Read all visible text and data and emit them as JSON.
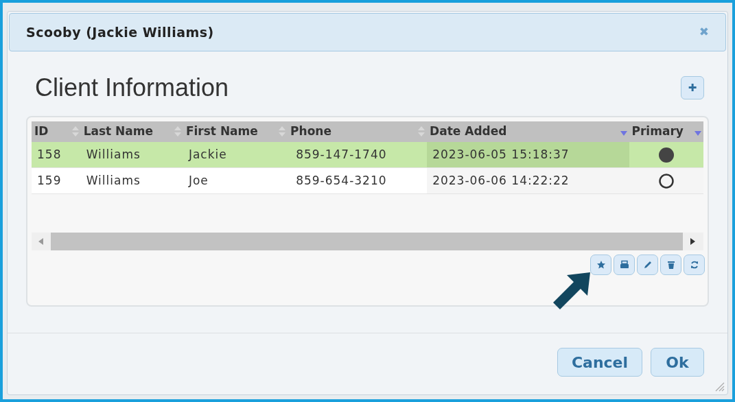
{
  "window": {
    "title": "Scooby (Jackie Williams)",
    "close": "✖"
  },
  "heading": "Client Information",
  "add_button": "✚",
  "table": {
    "columns": [
      {
        "label": "ID",
        "sorted": false
      },
      {
        "label": "Last Name",
        "sorted": false
      },
      {
        "label": "First Name",
        "sorted": false
      },
      {
        "label": "Phone",
        "sorted": false
      },
      {
        "label": "Date Added",
        "sorted": true
      },
      {
        "label": "Primary",
        "sorted": true
      }
    ],
    "rows": [
      {
        "cells": [
          "158",
          "Williams",
          "Jackie",
          "859-147-1740",
          "2023-06-05 15:18:37"
        ],
        "primary": true,
        "selected": true
      },
      {
        "cells": [
          "159",
          "Williams",
          "Joe",
          "859-654-3210",
          "2023-06-06 14:22:22"
        ],
        "primary": false,
        "selected": false
      }
    ]
  },
  "toolbar": [
    {
      "kind": "star"
    },
    {
      "kind": "print"
    },
    {
      "kind": "edit"
    },
    {
      "kind": "delete"
    },
    {
      "kind": "refresh"
    }
  ],
  "buttons": [
    "Cancel",
    "Ok"
  ]
}
